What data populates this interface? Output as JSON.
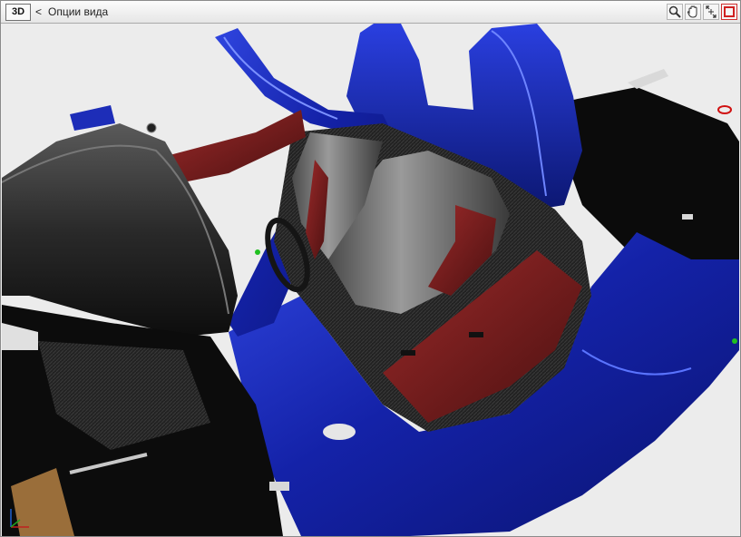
{
  "window": {
    "mode_label": "3D",
    "back_label": "<",
    "title": "Опции вида"
  },
  "toolbar": {
    "tools": [
      {
        "name": "zoom",
        "icon": "magnifier-icon"
      },
      {
        "name": "pan",
        "icon": "hand-icon"
      },
      {
        "name": "orbit",
        "icon": "orbit-icon"
      },
      {
        "name": "close",
        "icon": "close-square-icon"
      }
    ]
  },
  "scene": {
    "subject": "car-interior-model",
    "colors": {
      "body": "#1b2bb0",
      "body_highlight": "#5f78ff",
      "interior_dark": "#1a1a1a",
      "seat_gray": "#8a8a8a",
      "seat_red": "#7a1f1f",
      "background": "#ececec",
      "floor_tan": "#9a6e3a"
    }
  }
}
